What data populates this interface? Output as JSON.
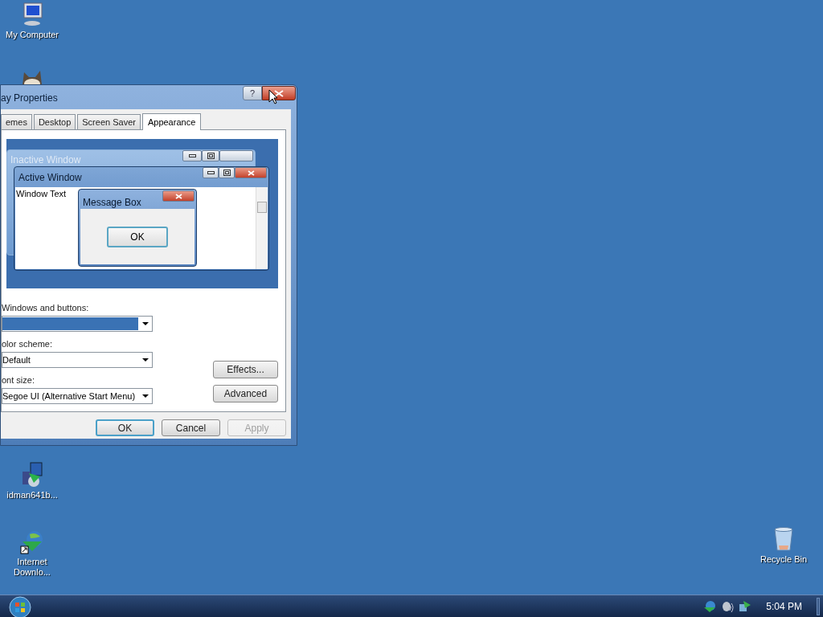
{
  "desktop_icons": [
    {
      "kind": "computer",
      "label": "My Computer"
    },
    {
      "kind": "installer",
      "label": "idman641b..."
    },
    {
      "kind": "globe",
      "label": "Internet Downlo..."
    },
    {
      "kind": "bin",
      "label": "Recycle Bin"
    }
  ],
  "window": {
    "title": "ay Properties",
    "help_button": "?",
    "tabs": [
      {
        "label": "emes",
        "selected": false
      },
      {
        "label": "Desktop",
        "selected": false
      },
      {
        "label": "Screen Saver",
        "selected": false
      },
      {
        "label": "Appearance",
        "selected": true
      }
    ],
    "preview": {
      "inactive_title": "Inactive Window",
      "active_title": "Active Window",
      "window_text": "Window Text",
      "message_title": "Message Box",
      "message_button": "OK"
    },
    "fields": [
      {
        "label": "Windows and buttons:",
        "focused": true
      },
      {
        "label": "olor scheme:",
        "value": "Default",
        "focused": false
      },
      {
        "label": "ont size:",
        "value": "Segoe UI (Alternative Start Menu)",
        "focused": false
      }
    ],
    "side_buttons": [
      "Effects...",
      "Advanced"
    ],
    "buttons": [
      {
        "label": "OK",
        "default": true,
        "disabled": false
      },
      {
        "label": "Cancel",
        "default": false,
        "disabled": false
      },
      {
        "label": "Apply",
        "default": false,
        "disabled": true
      }
    ]
  },
  "taskbar": {
    "time": "5:04 PM"
  }
}
